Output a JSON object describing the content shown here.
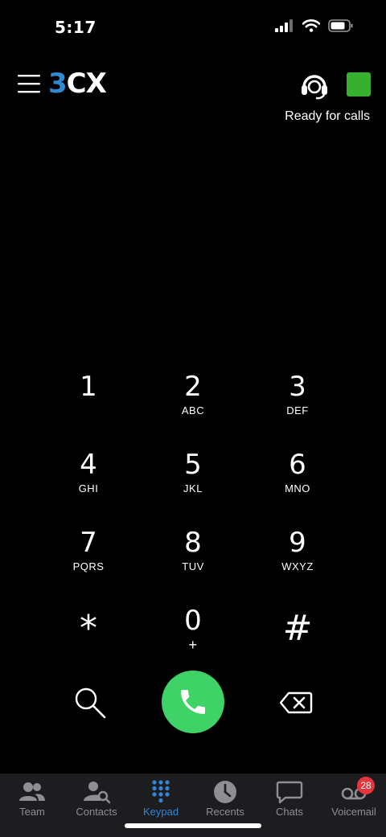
{
  "status_bar": {
    "time": "5:17"
  },
  "header": {
    "logo": {
      "part1": "3",
      "part2": "C",
      "part3": "X"
    },
    "status_text": "Ready for calls",
    "presence_color": "#37b030"
  },
  "keypad": {
    "keys": [
      {
        "digit": "1",
        "letters": ""
      },
      {
        "digit": "2",
        "letters": "ABC"
      },
      {
        "digit": "3",
        "letters": "DEF"
      },
      {
        "digit": "4",
        "letters": "GHI"
      },
      {
        "digit": "5",
        "letters": "JKL"
      },
      {
        "digit": "6",
        "letters": "MNO"
      },
      {
        "digit": "7",
        "letters": "PQRS"
      },
      {
        "digit": "8",
        "letters": "TUV"
      },
      {
        "digit": "9",
        "letters": "WXYZ"
      },
      {
        "digit": "*",
        "letters": ""
      },
      {
        "digit": "0",
        "letters": "+"
      },
      {
        "digit": "#",
        "letters": ""
      }
    ]
  },
  "actions": {
    "call_color": "#3ed267"
  },
  "tabs": [
    {
      "label": "Team",
      "icon": "team-icon"
    },
    {
      "label": "Contacts",
      "icon": "contacts-icon"
    },
    {
      "label": "Keypad",
      "icon": "keypad-icon",
      "active": true
    },
    {
      "label": "Recents",
      "icon": "clock-icon"
    },
    {
      "label": "Chats",
      "icon": "chat-icon"
    },
    {
      "label": "Voicemail",
      "icon": "voicemail-icon",
      "badge": "28"
    }
  ],
  "colors": {
    "accent": "#2f86d9",
    "badge": "#e5373b"
  }
}
